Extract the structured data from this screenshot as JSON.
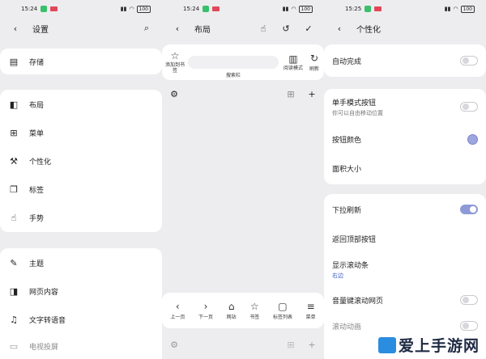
{
  "panel1": {
    "status": {
      "time": "15:24",
      "battery": "100"
    },
    "title": "设置",
    "group1": [
      {
        "icon": "storage-icon",
        "label": "存储"
      }
    ],
    "group2": [
      {
        "icon": "layout-icon",
        "label": "布局"
      },
      {
        "icon": "menu-icon",
        "label": "菜单"
      },
      {
        "icon": "wrench-icon",
        "label": "个性化"
      },
      {
        "icon": "tabs-icon",
        "label": "标签"
      },
      {
        "icon": "gesture-icon",
        "label": "手势"
      }
    ],
    "group3": [
      {
        "icon": "theme-icon",
        "label": "主题"
      },
      {
        "icon": "web-content-icon",
        "label": "网页内容"
      },
      {
        "icon": "tts-icon",
        "label": "文字转语音"
      },
      {
        "icon": "tv-cast-icon",
        "label": "电视投屏"
      }
    ]
  },
  "panel2": {
    "status": {
      "time": "15:24",
      "battery": "100"
    },
    "title": "布局",
    "top_toolbar": {
      "add_bookmark": "添加到书签",
      "search_bar": "搜索栏",
      "reading_mode": "阅读模式",
      "refresh": "刷新"
    },
    "bottom_toolbar": [
      {
        "icon": "chevron-left-icon",
        "glyph": "‹",
        "label": "上一页"
      },
      {
        "icon": "chevron-right-icon",
        "glyph": "›",
        "label": "下一页"
      },
      {
        "icon": "home-icon",
        "glyph": "⌂",
        "label": "网站"
      },
      {
        "icon": "star-icon",
        "glyph": "☆",
        "label": "书签"
      },
      {
        "icon": "square-icon",
        "glyph": "▢",
        "label": "标签列表"
      },
      {
        "icon": "hamburger-icon",
        "glyph": "≡",
        "label": "菜单"
      }
    ]
  },
  "panel3": {
    "status": {
      "time": "15:25",
      "battery": "100"
    },
    "title": "个性化",
    "auto_complete": {
      "label": "自动完成",
      "on": false
    },
    "one_hand": {
      "label": "单手模式按钮",
      "sub": "你可以自由移动位置",
      "on": false
    },
    "button_color": {
      "label": "按钮颜色",
      "color": "#9ea6e0"
    },
    "area_size": {
      "label": "面积大小"
    },
    "pull_refresh": {
      "label": "下拉刷新",
      "on": true
    },
    "back_to_top": {
      "label": "返回顶部按钮"
    },
    "scrollbar": {
      "label": "显示滚动条",
      "sub": "右边"
    },
    "volume_scroll": {
      "label": "音量键滚动网页",
      "on": false
    },
    "scroll_anim": {
      "label": "滚动动画",
      "on": false
    }
  },
  "watermark": "爱上手游网"
}
